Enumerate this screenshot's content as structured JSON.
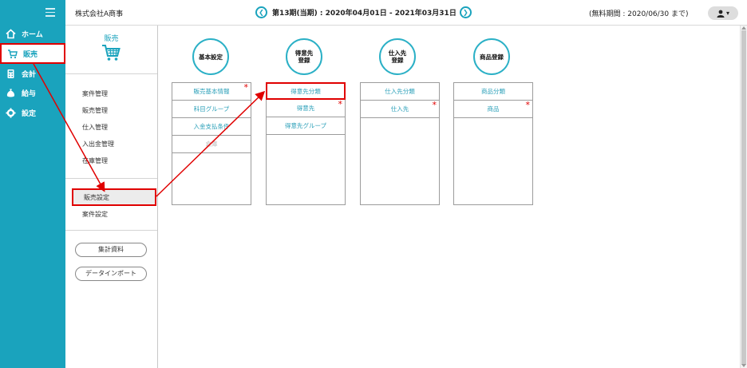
{
  "header": {
    "company": "株式会社A商事",
    "period": "第13期(当期) : 2020年04月01日 - 2021年03月31日",
    "trial": "(無料期間 : 2020/06/30 まで)",
    "user_caret": "▾"
  },
  "leftnav": {
    "items": [
      {
        "label": "ホーム",
        "icon": "home-icon"
      },
      {
        "label": "販売",
        "icon": "cart-icon"
      },
      {
        "label": "会計",
        "icon": "calculator-icon"
      },
      {
        "label": "給与",
        "icon": "money-bag-icon"
      },
      {
        "label": "設定",
        "icon": "gear-icon"
      }
    ]
  },
  "submenu": {
    "title": "販売",
    "groups1": [
      "案件管理",
      "販売管理",
      "仕入管理",
      "入出金管理",
      "在庫管理"
    ],
    "groups2": [
      "販売設定",
      "案件設定"
    ],
    "buttons": [
      "集計資料",
      "データインポート"
    ]
  },
  "categories": [
    {
      "title_lines": [
        "基本設定"
      ],
      "rows": [
        {
          "label": "販売基本情報",
          "required": true
        },
        {
          "label": "科目グループ",
          "required": false
        },
        {
          "label": "入金支払条件",
          "required": false
        },
        {
          "label": "倉庫",
          "required": false
        }
      ]
    },
    {
      "title_lines": [
        "得意先",
        "登録"
      ],
      "rows": [
        {
          "label": "得意先分類",
          "required": false
        },
        {
          "label": "得意先",
          "required": true
        },
        {
          "label": "得意先グループ",
          "required": false
        }
      ]
    },
    {
      "title_lines": [
        "仕入先",
        "登録"
      ],
      "rows": [
        {
          "label": "仕入先分類",
          "required": false
        },
        {
          "label": "仕入先",
          "required": true
        }
      ]
    },
    {
      "title_lines": [
        "商品登録"
      ],
      "rows": [
        {
          "label": "商品分類",
          "required": false
        },
        {
          "label": "商品",
          "required": true
        }
      ]
    }
  ],
  "colors": {
    "accent": "#1aa3bd",
    "highlight": "#e00000"
  }
}
